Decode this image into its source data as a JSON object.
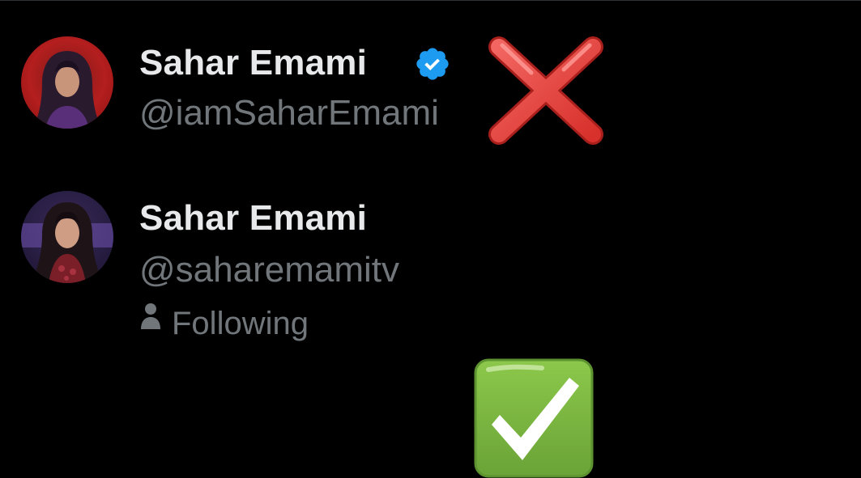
{
  "accounts": [
    {
      "display_name": "Sahar Emami",
      "handle": "@iamSaharEmami",
      "verified": true,
      "avatar_icon": "avatar-photo",
      "mark_icon": "cross-mark-icon",
      "verified_color": "#1d9bf0"
    },
    {
      "display_name": "Sahar Emami",
      "handle": "@saharemamitv",
      "verified": false,
      "following_label": "Following",
      "avatar_icon": "avatar-photo",
      "mark_icon": "check-mark-button-icon"
    }
  ],
  "colors": {
    "background": "#000000",
    "primary_text": "#e7e9ea",
    "secondary_text": "#71767b",
    "cross_red": "#e8403c",
    "check_green": "#7cb342"
  }
}
